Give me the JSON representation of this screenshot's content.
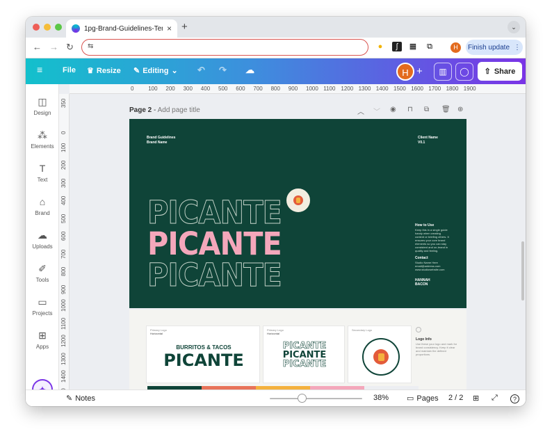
{
  "browser": {
    "tab_title": "1pg-Brand-Guidelines-Templ",
    "tab_close": "×",
    "new_tab": "+",
    "tab_menu": "⌄",
    "url_icon": "⇆",
    "finish_update": "Finish update",
    "profile_initial": "H"
  },
  "toolbar": {
    "file": "File",
    "resize": "Resize",
    "editing": "Editing",
    "share": "Share",
    "user_initial": "H"
  },
  "sidebar": {
    "items": [
      {
        "label": "Design",
        "icon": "design-icon"
      },
      {
        "label": "Elements",
        "icon": "elements-icon"
      },
      {
        "label": "Text",
        "icon": "text-icon"
      },
      {
        "label": "Brand",
        "icon": "brand-icon"
      },
      {
        "label": "Uploads",
        "icon": "uploads-icon"
      },
      {
        "label": "Tools",
        "icon": "tools-icon"
      },
      {
        "label": "Projects",
        "icon": "projects-icon"
      },
      {
        "label": "Apps",
        "icon": "apps-icon"
      }
    ]
  },
  "ruler": {
    "h": [
      "0",
      "100",
      "200",
      "300",
      "400",
      "500",
      "600",
      "700",
      "800",
      "900",
      "1000",
      "1100",
      "1200",
      "1300",
      "1400",
      "1500",
      "1600",
      "1700",
      "1800",
      "1900"
    ],
    "v": [
      "350",
      "0",
      "100",
      "200",
      "300",
      "400",
      "500",
      "600",
      "700",
      "800",
      "900",
      "1000",
      "1100",
      "1200",
      "1300",
      "1400",
      "1500"
    ]
  },
  "page": {
    "label": "Page 2",
    "separator": " - ",
    "add_title": "Add page title"
  },
  "design": {
    "brand_guidelines": "Brand Guidelines",
    "brand_name": "Brand Name",
    "client_name": "Client Name",
    "version": "V0.1",
    "word": "PICANTE",
    "how_to_use": "How to Use",
    "how_to_use_body": "Keep this in a single guide handy when creating content or briefing others. It ensures your core brand elements so you can stay consistent and on-brand in quality and feeling.",
    "contact": "Contact",
    "contact_body": "Studio Name Here email@address.com www.studiowebsite.com",
    "studio": "HANNAH BACON",
    "primary_logo": "Primary Logo",
    "horizontal": "Horizontal",
    "secondary_logo": "Secondary Logo",
    "logo_tagline": "BURRITOS & TACOS",
    "logo_word": "PICANTE",
    "logo_info": "Logo Info",
    "logo_info_body": "Use these your logo and mark for brand consistency. Keep it clear and maintain the defined proportions."
  },
  "status": {
    "notes": "Notes",
    "zoom": "38%",
    "pages": "Pages",
    "page_count": "2 / 2",
    "help": "?"
  }
}
